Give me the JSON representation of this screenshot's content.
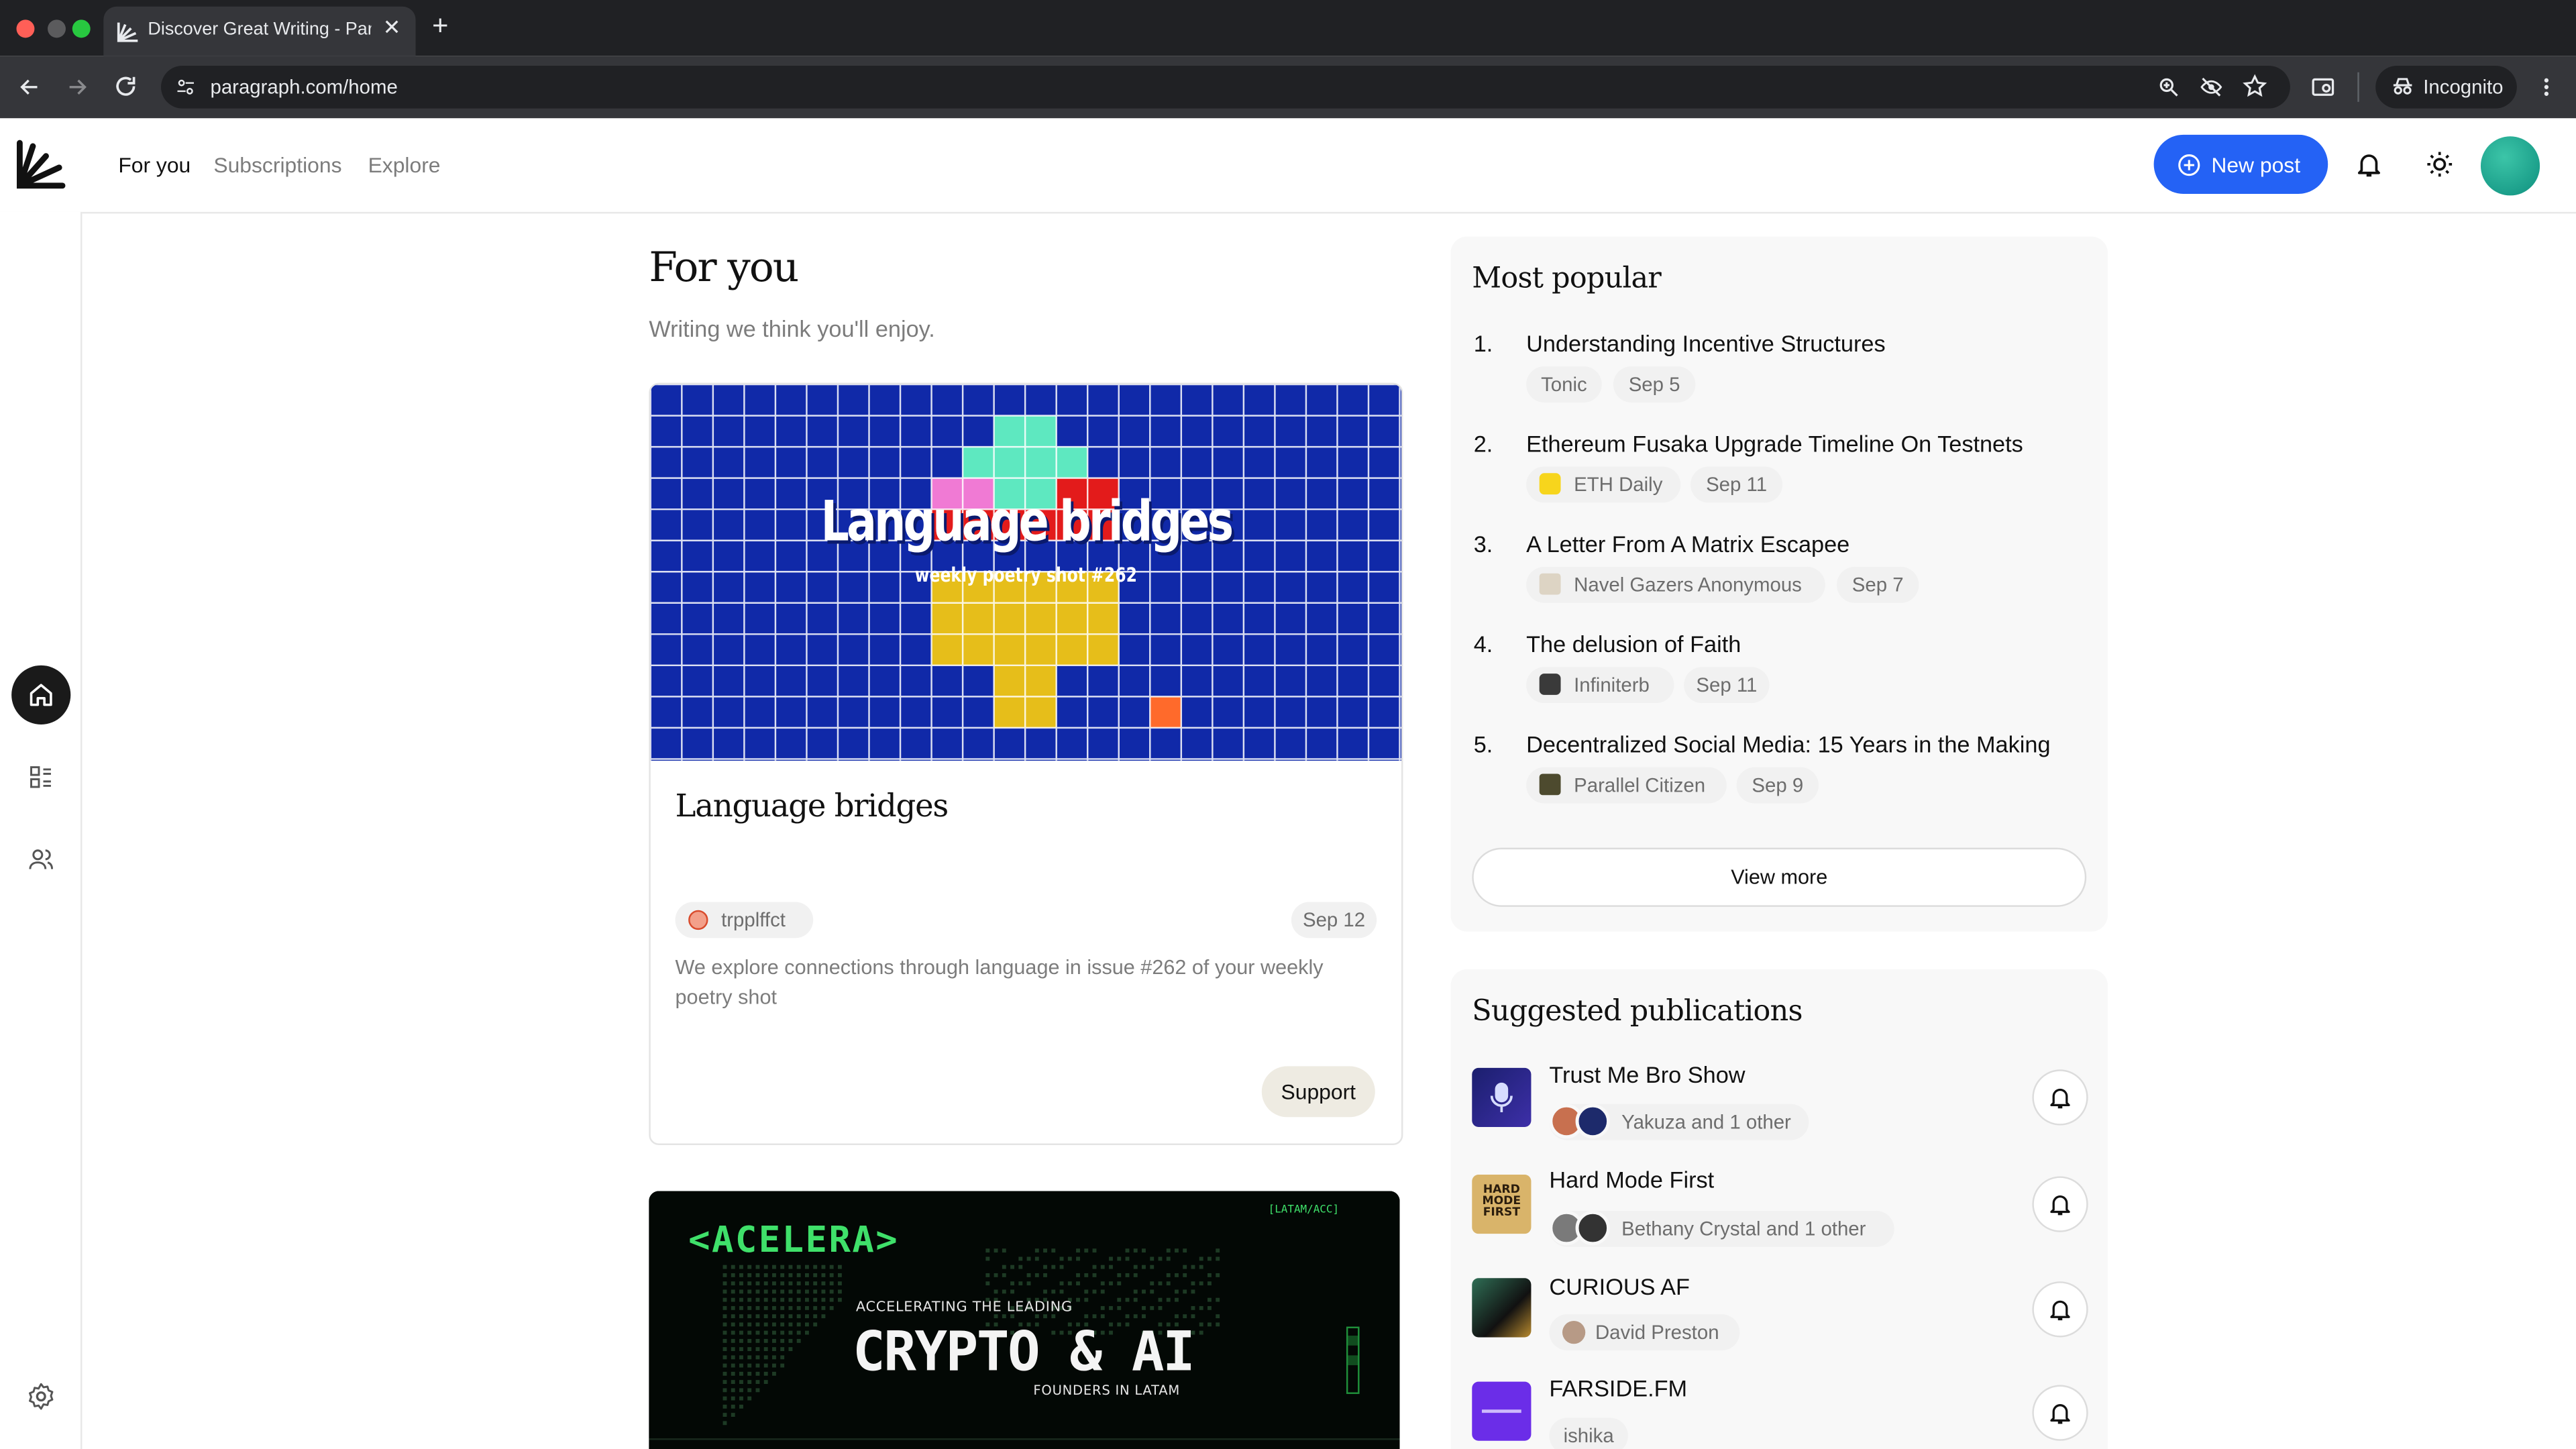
{
  "browser": {
    "tab_title": "Discover Great Writing - Paragraph",
    "new_tab_symbol": "+",
    "close_symbol": "✕",
    "url": "paragraph.com/home",
    "incognito_label": "Incognito",
    "colors": {
      "tabstrip": "#202124",
      "toolbar": "#35363a"
    }
  },
  "nav": {
    "tabs": [
      {
        "label": "For you",
        "active": true
      },
      {
        "label": "Subscriptions",
        "active": false
      },
      {
        "label": "Explore",
        "active": false
      }
    ],
    "new_post_label": "New post",
    "accent": "#2462f5"
  },
  "sidebar": {
    "items": [
      {
        "icon": "home-icon",
        "active": true
      },
      {
        "icon": "feed-list-icon",
        "active": false
      },
      {
        "icon": "people-icon",
        "active": false
      }
    ],
    "settings_icon": "gear-icon"
  },
  "main": {
    "title": "For you",
    "subtitle": "Writing we think you'll enjoy."
  },
  "posts": [
    {
      "image_title": "Language bridges",
      "image_subtitle": "weekly poetry shot #262",
      "title": "Language bridges",
      "author": "trpplffct",
      "date": "Sep 12",
      "description": "We explore connections through language in issue #262 of your weekly poetry shot",
      "support_label": "Support"
    },
    {
      "image_brand": "<ACELERA>",
      "image_tag": "[LATAM/ACC]",
      "image_line1": "ACCELERATING THE LEADING",
      "image_headline": "CRYPTO & AI",
      "image_line2": "FOUNDERS IN LATAM"
    }
  ],
  "most_popular": {
    "title": "Most popular",
    "items": [
      {
        "rank": "1.",
        "title": "Understanding Incentive Structures",
        "publication": "Tonic",
        "date": "Sep 5"
      },
      {
        "rank": "2.",
        "title": "Ethereum Fusaka Upgrade Timeline On Testnets",
        "publication": "ETH Daily",
        "date": "Sep 11"
      },
      {
        "rank": "3.",
        "title": "A Letter From A Matrix Escapee",
        "publication": "Navel Gazers Anonymous",
        "date": "Sep 7"
      },
      {
        "rank": "4.",
        "title": "The delusion of Faith",
        "publication": "Infiniterb",
        "date": "Sep 11"
      },
      {
        "rank": "5.",
        "title": "Decentralized Social Media: 15 Years in the Making",
        "publication": "Parallel Citizen",
        "date": "Sep 9"
      }
    ],
    "view_more_label": "View more"
  },
  "suggested": {
    "title": "Suggested publications",
    "items": [
      {
        "name": "Trust Me Bro Show",
        "subscribers": "Yakuza and 1 other"
      },
      {
        "name": "Hard Mode First",
        "subscribers": "Bethany Crystal and 1 other",
        "logo_text": "HARD MODE FIRST"
      },
      {
        "name": "CURIOUS AF",
        "subscribers": "David Preston"
      },
      {
        "name": "FARSIDE.FM",
        "subscribers": "ishika"
      }
    ]
  }
}
